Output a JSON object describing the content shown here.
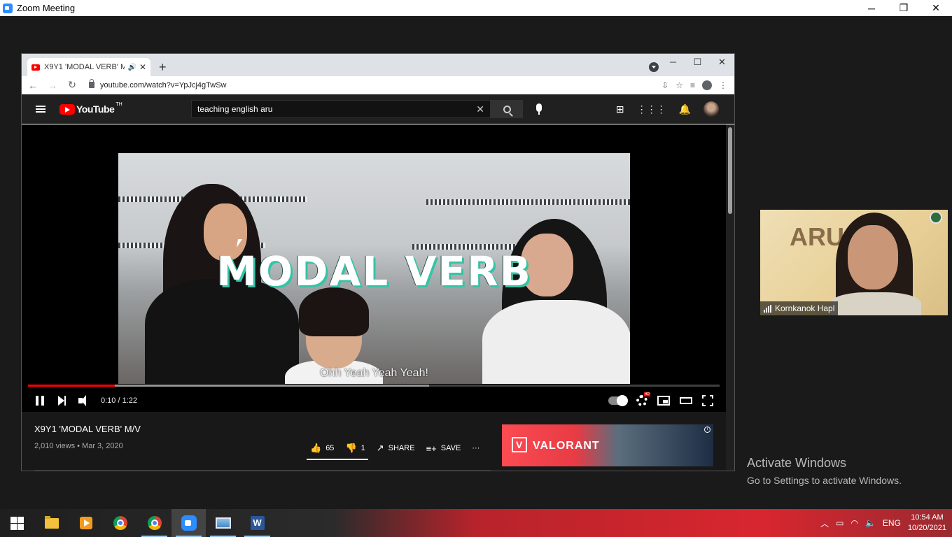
{
  "zoom": {
    "title": "Zoom Meeting",
    "minimize": "─",
    "restore": "❐",
    "close": "✕"
  },
  "browser": {
    "tab_title": "X9Y1 'MODAL VERB' M/V - Y",
    "tab_close": "✕",
    "new_tab": "+",
    "url": "youtube.com/watch?v=YpJcj4gTwSw",
    "win_minimize": "─",
    "win_maximize": "☐",
    "win_close": "✕"
  },
  "youtube": {
    "logo_text": "YouTube",
    "country": "TH",
    "search_query": "teaching english aru",
    "search_clear": "✕"
  },
  "video": {
    "overlay_title": "MODAL VERB",
    "subtitle": "Ohh Yeah Yeah Yeah!",
    "current_time": "0:10",
    "duration": "1:22",
    "time_display": "0:10 / 1:22",
    "played_fraction": 0.126,
    "buffered_fraction": 0.58,
    "hd_badge": "HD"
  },
  "info": {
    "title": "X9Y1 'MODAL VERB' M/V",
    "views_date": "2,010 views • Mar 3, 2020",
    "likes": "65",
    "dislikes": "1",
    "share_label": "SHARE",
    "save_label": "SAVE",
    "more": "···",
    "ad_brand": "VALORANT",
    "ad_info": "i"
  },
  "participant": {
    "name": "Kornkanok Hapl",
    "bg_text": "ARU"
  },
  "watermark": {
    "title": "Activate Windows",
    "subtitle": "Go to Settings to activate Windows."
  },
  "taskbar": {
    "word_letter": "W",
    "language": "ENG",
    "time": "10:54 AM",
    "date": "10/20/2021"
  }
}
